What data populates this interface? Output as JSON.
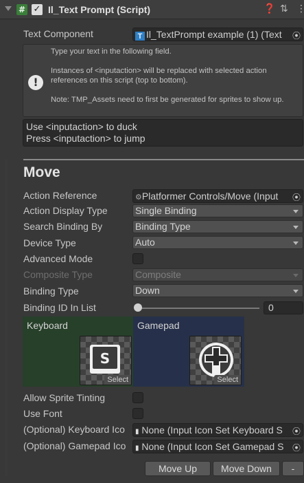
{
  "header": {
    "title": "Il_Text Prompt (Script)",
    "help_icon": "question-icon",
    "preset_icon": "preset-sliders-icon",
    "more_icon": "kebab-menu-icon"
  },
  "text_component": {
    "label": "Text Component",
    "value": "Il_TextPrompt example (1) (Text"
  },
  "help": {
    "line1": "Type your text in the following field.",
    "line2": "Instances of <inputaction> will be replaced with selected action references on this script (top to bottom).",
    "line3": "Note: TMP_Assets need to first be generated for sprites to show up."
  },
  "prompt_text": {
    "line1": "Use <inputaction> to duck",
    "line2": "Press <inputaction> to jump"
  },
  "section": {
    "title": "Move"
  },
  "fields": {
    "action_reference": {
      "label": "Action Reference",
      "value": "Platformer Controls/Move (Input"
    },
    "action_display_type": {
      "label": "Action Display Type",
      "value": "Single Binding"
    },
    "search_binding_by": {
      "label": "Search Binding By",
      "value": "Binding Type"
    },
    "device_type": {
      "label": "Device Type",
      "value": "Auto"
    },
    "advanced_mode": {
      "label": "Advanced Mode",
      "checked": false
    },
    "composite_type": {
      "label": "Composite Type",
      "value": "Composite"
    },
    "binding_type": {
      "label": "Binding Type",
      "value": "Down"
    },
    "binding_id": {
      "label": "Binding ID In List",
      "value": "0"
    }
  },
  "panels": {
    "keyboard": {
      "label": "Keyboard",
      "select": "Select",
      "key_letter": "S",
      "color": "#27402a"
    },
    "gamepad": {
      "label": "Gamepad",
      "select": "Select",
      "color": "#26304a"
    }
  },
  "options": {
    "allow_sprite_tinting": {
      "label": "Allow Sprite Tinting",
      "checked": false
    },
    "use_font": {
      "label": "Use Font",
      "checked": false
    },
    "keyboard_icons": {
      "label": "(Optional) Keyboard Ico",
      "value": "None (Input Icon Set Keyboard S"
    },
    "gamepad_icons": {
      "label": "(Optional) Gamepad Ico",
      "value": "None (Input Icon Set Gamepad S"
    }
  },
  "buttons": {
    "move_up": "Move Up",
    "move_down": "Move Down",
    "remove": "-"
  }
}
